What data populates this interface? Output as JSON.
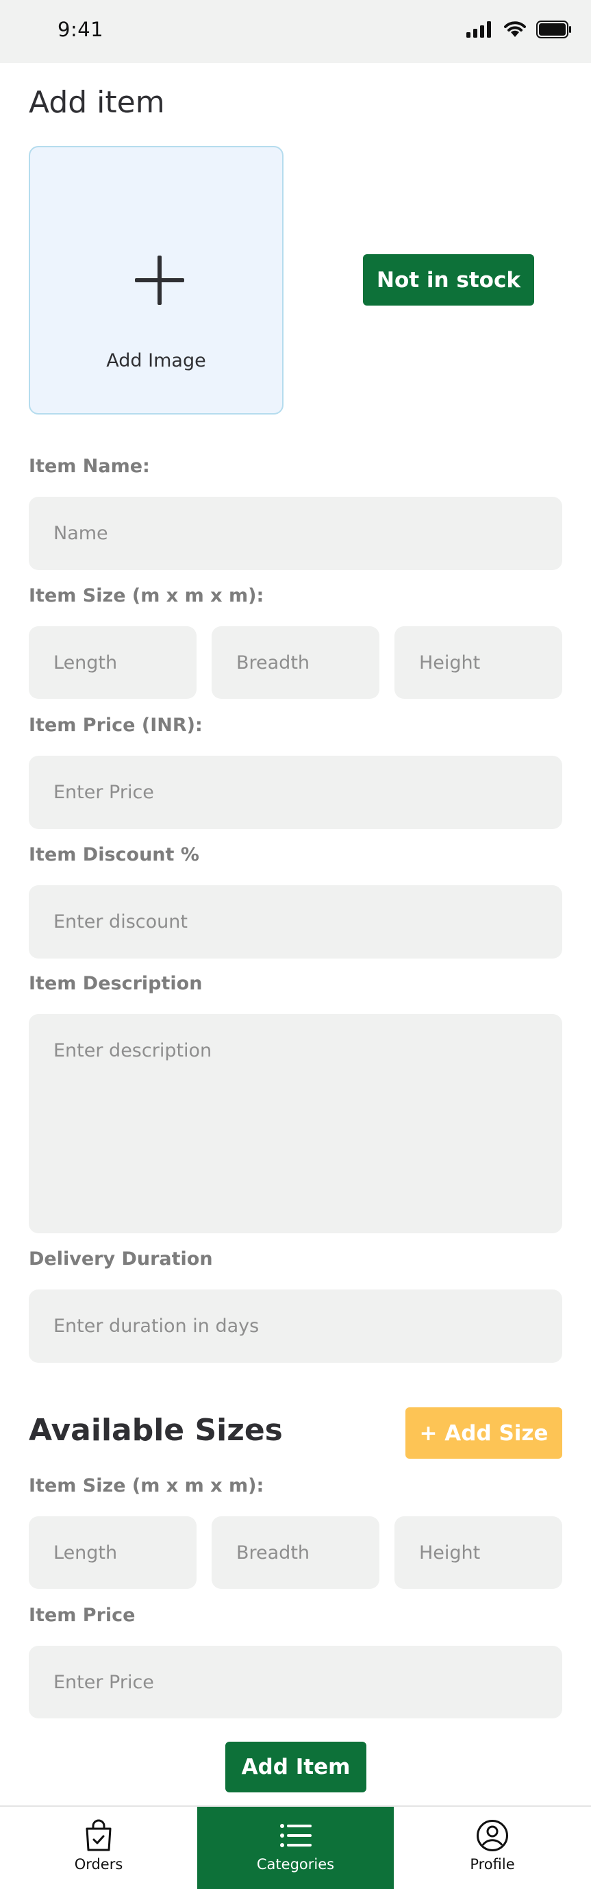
{
  "status_bar": {
    "time": "9:41"
  },
  "page_title": "Add item",
  "image_upload": {
    "label": "Add Image"
  },
  "stock_button": {
    "label": "Not in stock"
  },
  "item_name": {
    "label": "Item Name:",
    "placeholder": "Name"
  },
  "item_size": {
    "label": "Item Size (m x m x m):",
    "length_placeholder": "Length",
    "breadth_placeholder": "Breadth",
    "height_placeholder": "Height"
  },
  "item_price": {
    "label": "Item Price (INR):",
    "placeholder": "Enter Price"
  },
  "item_discount": {
    "label": "Item Discount %",
    "placeholder": "Enter discount"
  },
  "item_description": {
    "label": "Item Description",
    "placeholder": "Enter description"
  },
  "delivery_duration": {
    "label": "Delivery Duration",
    "placeholder": "Enter duration in days"
  },
  "available_sizes": {
    "title": "Available Sizes",
    "add_size_label": "+ Add Size",
    "size_label": "Item Size (m x m x m):",
    "length_placeholder": "Length",
    "breadth_placeholder": "Breadth",
    "height_placeholder": "Height",
    "price_label": "Item Price",
    "price_placeholder": "Enter Price"
  },
  "add_item_button": {
    "label": "Add Item"
  },
  "bottom_nav": {
    "items": [
      {
        "label": "Orders",
        "icon": "shopping-bag-icon",
        "active": false
      },
      {
        "label": "Categories",
        "icon": "list-icon",
        "active": true
      },
      {
        "label": "Profile",
        "icon": "user-circle-icon",
        "active": false
      }
    ]
  },
  "colors": {
    "primary_green": "#0d7139",
    "accent_yellow": "#fdc455",
    "input_bg": "#f0f1f0",
    "image_box_bg": "#edf4fd"
  }
}
